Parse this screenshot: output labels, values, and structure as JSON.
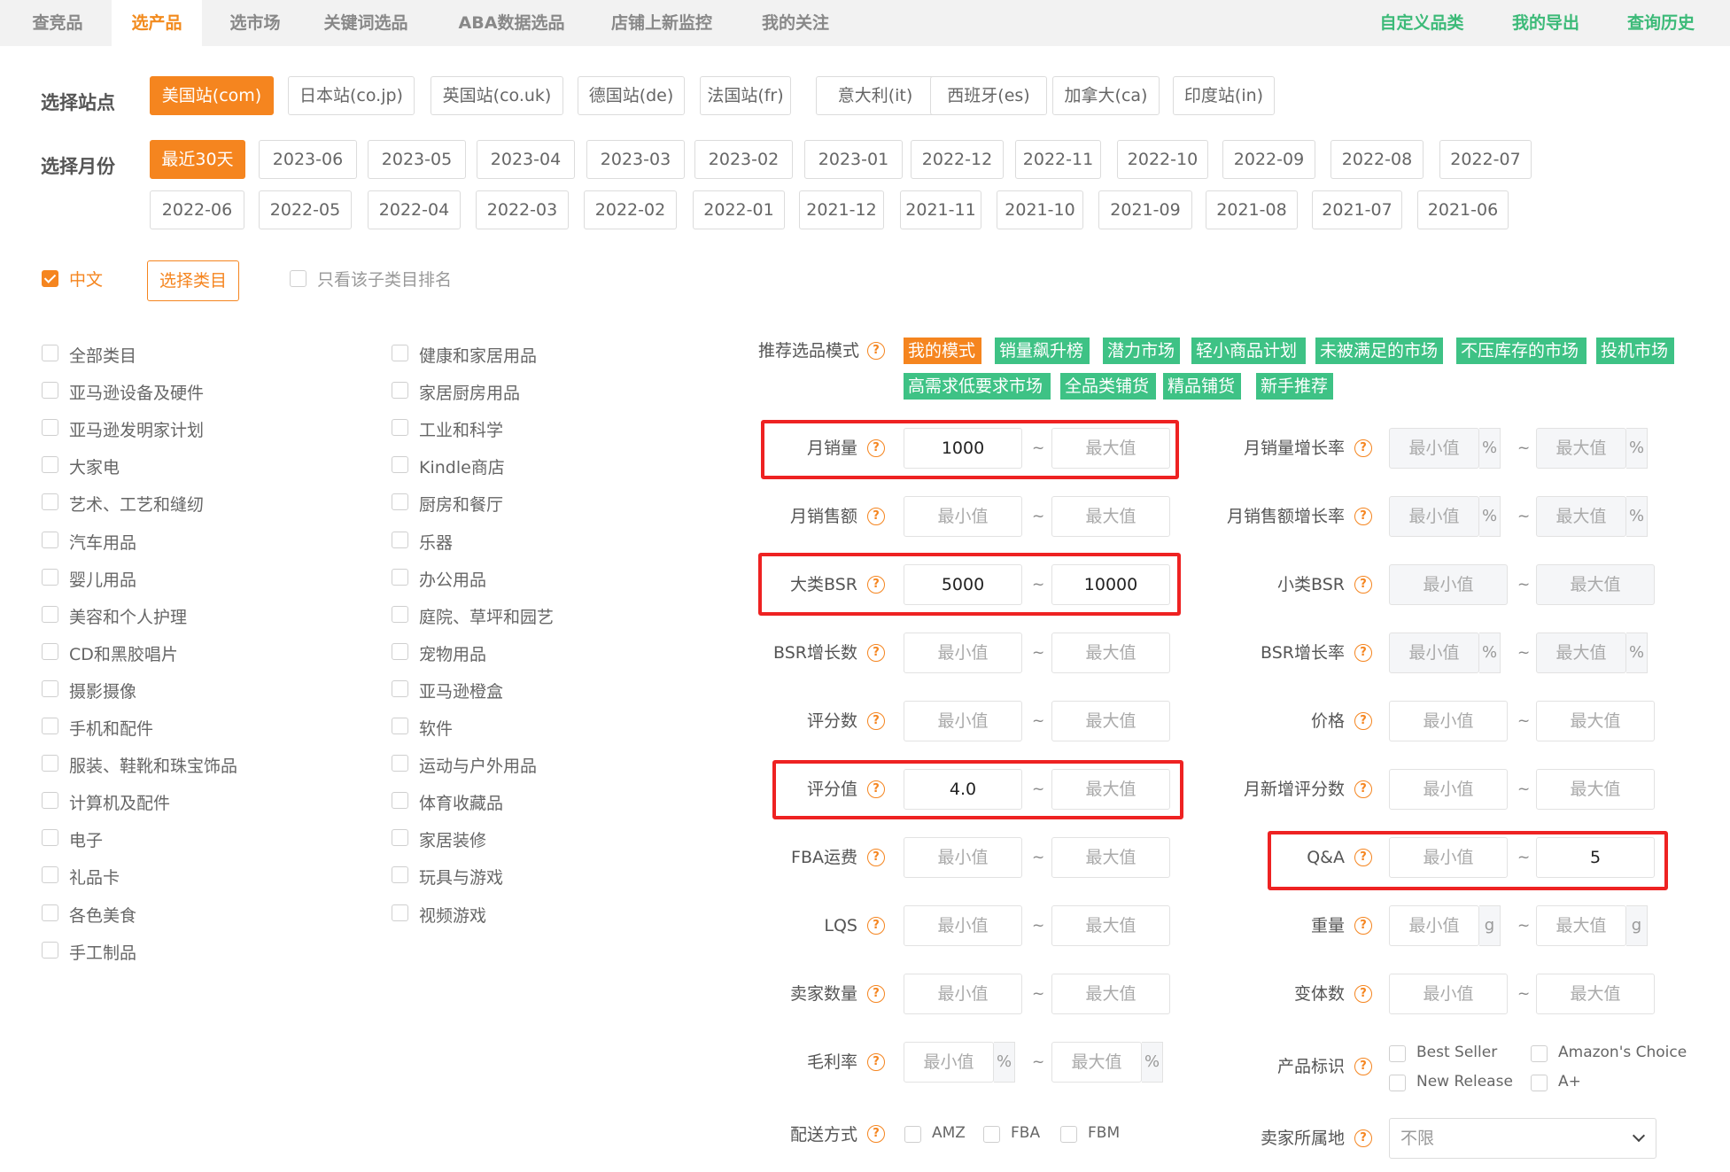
{
  "nav": {
    "tabs": [
      "查竞品",
      "选产品",
      "选市场",
      "关键词选品",
      "ABA数据选品",
      "店铺上新监控",
      "我的关注"
    ],
    "active_tab": "选产品",
    "right_links": [
      "自定义品类",
      "我的导出",
      "查询历史"
    ]
  },
  "site": {
    "label": "选择站点",
    "options": [
      "美国站(com)",
      "日本站(co.jp)",
      "英国站(co.uk)",
      "德国站(de)",
      "法国站(fr)",
      "意大利(it)",
      "西班牙(es)",
      "加拿大(ca)",
      "印度站(in)"
    ],
    "selected": "美国站(com)"
  },
  "month": {
    "label": "选择月份",
    "row1": [
      "最近30天",
      "2023-06",
      "2023-05",
      "2023-04",
      "2023-03",
      "2023-02",
      "2023-01",
      "2022-12",
      "2022-11",
      "2022-10",
      "2022-09",
      "2022-08",
      "2022-07"
    ],
    "row2": [
      "2022-06",
      "2022-05",
      "2022-04",
      "2022-03",
      "2022-02",
      "2022-01",
      "2021-12",
      "2021-11",
      "2021-10",
      "2021-09",
      "2021-08",
      "2021-07",
      "2021-06"
    ],
    "selected": "最近30天"
  },
  "options": {
    "chinese_label": "中文",
    "chinese_checked": true,
    "select_category_button": "选择类目",
    "only_sub_label": "只看该子类目排名"
  },
  "categories": {
    "col1": [
      "全部类目",
      "亚马逊设备及硬件",
      "亚马逊发明家计划",
      "大家电",
      "艺术、工艺和缝纫",
      "汽车用品",
      "婴儿用品",
      "美容和个人护理",
      "CD和黑胶唱片",
      "摄影摄像",
      "手机和配件",
      "服装、鞋靴和珠宝饰品",
      "计算机及配件",
      "电子",
      "礼品卡",
      "各色美食",
      "手工制品"
    ],
    "col2": [
      "健康和家居用品",
      "家居厨房用品",
      "工业和科学",
      "Kindle商店",
      "厨房和餐厅",
      "乐器",
      "办公用品",
      "庭院、草坪和园艺",
      "宠物用品",
      "亚马逊橙盒",
      "软件",
      "运动与户外用品",
      "体育收藏品",
      "家居装修",
      "玩具与游戏",
      "视频游戏"
    ]
  },
  "mode": {
    "label": "推荐选品模式",
    "tags_row1": [
      "我的模式",
      "销量飙升榜",
      "潜力市场",
      "轻小商品计划",
      "未被满足的市场",
      "不压库存的市场",
      "投机市场"
    ],
    "tags_row2": [
      "高需求低要求市场",
      "全品类铺货",
      "精品铺货",
      "新手推荐"
    ],
    "active_tag": "我的模式"
  },
  "filters": {
    "help_glyph": "?",
    "tilde": "~",
    "min_placeholder": "最小值",
    "max_placeholder": "最大值",
    "left": [
      {
        "label": "月销量",
        "min": "1000",
        "max": ""
      },
      {
        "label": "月销售额",
        "min": "",
        "max": ""
      },
      {
        "label": "大类BSR",
        "min": "5000",
        "max": "10000"
      },
      {
        "label": "BSR增长数",
        "min": "",
        "max": ""
      },
      {
        "label": "评分数",
        "min": "",
        "max": ""
      },
      {
        "label": "评分值",
        "min": "4.0",
        "max": ""
      },
      {
        "label": "FBA运费",
        "min": "",
        "max": ""
      },
      {
        "label": "LQS",
        "min": "",
        "max": ""
      },
      {
        "label": "卖家数量",
        "min": "",
        "max": ""
      },
      {
        "label": "毛利率",
        "min": "",
        "max": "",
        "unit": "%"
      }
    ],
    "right": [
      {
        "label": "月销量增长率",
        "min": "",
        "max": "",
        "unit": "%"
      },
      {
        "label": "月销售额增长率",
        "min": "",
        "max": "",
        "unit": "%"
      },
      {
        "label": "小类BSR",
        "min": "",
        "max": ""
      },
      {
        "label": "BSR增长率",
        "min": "",
        "max": "",
        "unit": "%"
      },
      {
        "label": "价格",
        "min": "",
        "max": ""
      },
      {
        "label": "月新增评分数",
        "min": "",
        "max": ""
      },
      {
        "label": "Q&A",
        "min": "",
        "max": "5"
      },
      {
        "label": "重量",
        "min": "",
        "max": "",
        "unit": "g"
      },
      {
        "label": "变体数",
        "min": "",
        "max": ""
      }
    ],
    "shipping": {
      "label": "配送方式",
      "options": [
        "AMZ",
        "FBA",
        "FBM"
      ]
    },
    "badges": {
      "label": "产品标识",
      "options": [
        "Best Seller",
        "Amazon's Choice",
        "New Release",
        "A+"
      ]
    },
    "seller_location": {
      "label": "卖家所属地",
      "value": "不限"
    }
  },
  "colors": {
    "accent": "#f5851f",
    "green": "#3ec285",
    "highlight_box": "#ee2222"
  }
}
